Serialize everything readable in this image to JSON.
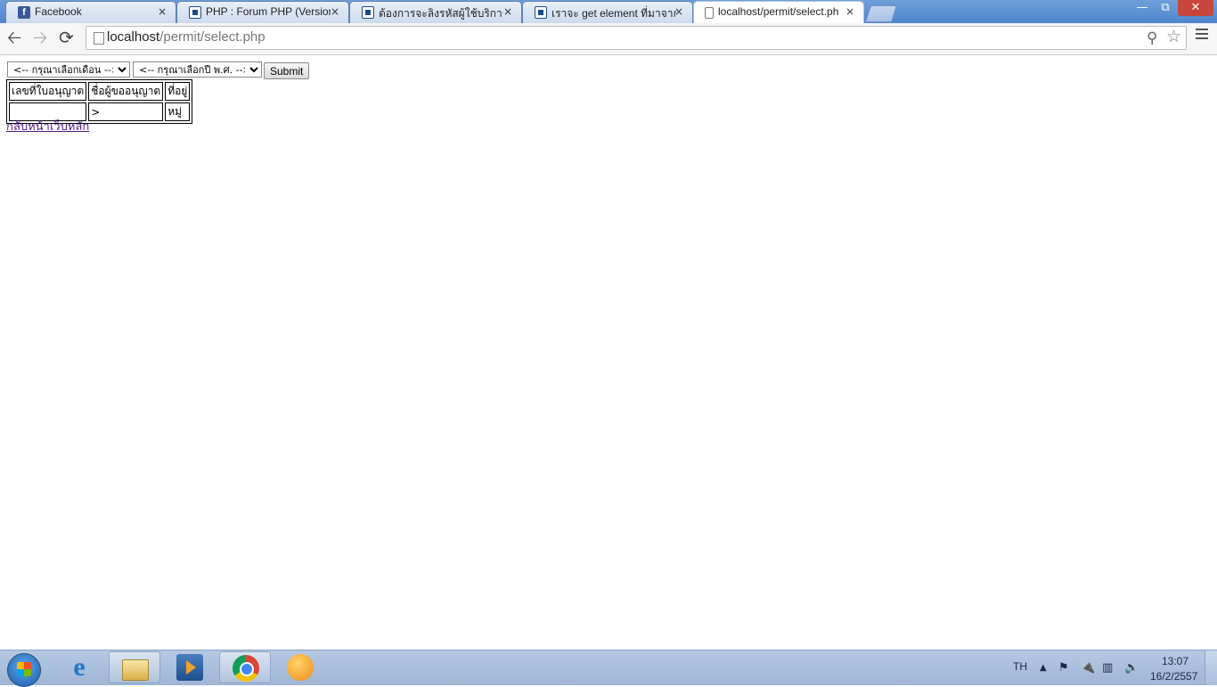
{
  "browser": {
    "tabs": [
      {
        "title": "Facebook",
        "icon": "facebook-icon",
        "active": false
      },
      {
        "title": "PHP : Forum PHP (Version",
        "icon": "forum-icon",
        "active": false
      },
      {
        "title": "ต้องการจะลิงรหัสผู้ใช้บริการ",
        "icon": "forum-icon",
        "active": false
      },
      {
        "title": "เราจะ get element ที่มาจาก",
        "icon": "forum-icon",
        "active": false
      },
      {
        "title": "localhost/permit/select.ph",
        "icon": "page-icon",
        "active": true
      }
    ],
    "close_glyph": "×",
    "url_host": "localhost",
    "url_path": "/permit/select.php"
  },
  "form": {
    "month_select": {
      "selected": "<-- กรุณาเลือกเดือน -->"
    },
    "year_select": {
      "selected": "<-- กรุณาเลือกปี พ.ศ. -->"
    },
    "submit_label": "Submit"
  },
  "table": {
    "headers": [
      "เลขที่ใบอนุญาต",
      "ชื่อผู้ขออนุญาต",
      "ที่อยู่"
    ],
    "rows": [
      [
        "",
        ">",
        "หมู่"
      ]
    ]
  },
  "back_link": "กลับหน้าเว็บหลัก",
  "taskbar": {
    "pinned": [
      "internet-explorer-icon",
      "file-explorer-icon",
      "media-player-icon",
      "chrome-icon",
      "smiley-app-icon"
    ],
    "language": "TH",
    "time": "13:07",
    "date": "16/2/2557"
  }
}
